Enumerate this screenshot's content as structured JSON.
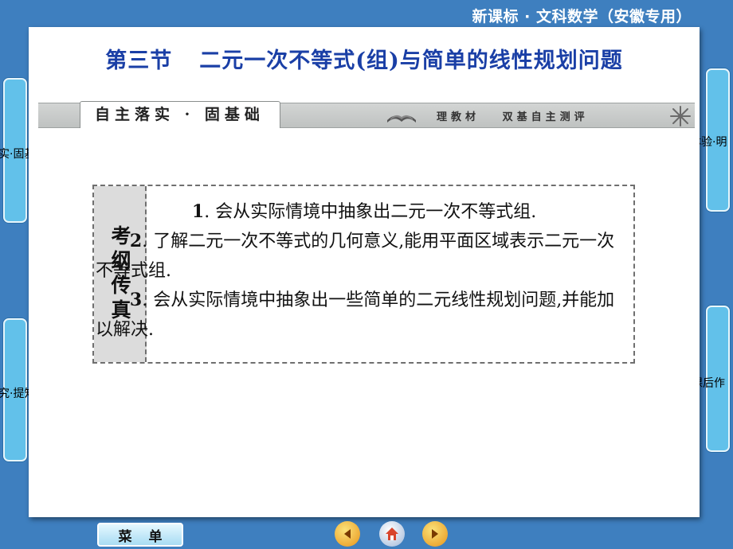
{
  "header": {
    "brand": "新课标 · 文科数学（安徽专用）"
  },
  "slide": {
    "title_part1": "第三节",
    "title_part2": "二元一次不等式(组)与简单的线性规划问题",
    "banner": {
      "tab_label": "自主落实 · 固基础",
      "sub_label": "理教材   双基自主测评"
    },
    "outline": {
      "label": "考纲传真",
      "items": [
        {
          "num": "1",
          "text": ". 会从实际情境中抽象出二元一次不等式组."
        },
        {
          "num": "2",
          "text": ". 了解二元一次不等式的几何意义,能用平面区域表示二元一次不等式组."
        },
        {
          "num": "3",
          "text": ". 会从实际情境中抽象出一些简单的二元线性规划问题,并能加以解决."
        }
      ]
    }
  },
  "sidebar_left": [
    {
      "label": "落实·固基础"
    },
    {
      "label": "探究·提知能"
    }
  ],
  "sidebar_right": [
    {
      "label": "高考体验·明"
    },
    {
      "label": "课后作"
    }
  ],
  "footer": {
    "menu_chars": [
      "菜",
      "单"
    ],
    "nav": [
      {
        "icon": "back-arrow-icon",
        "color": "#f0a020"
      },
      {
        "icon": "home-icon",
        "color": "#e05030"
      },
      {
        "icon": "forward-arrow-icon",
        "color": "#f0a020"
      }
    ]
  },
  "colors": {
    "background": "#3e7fbf",
    "title": "#1a3fa6",
    "side_tab": "#62c1ea"
  }
}
